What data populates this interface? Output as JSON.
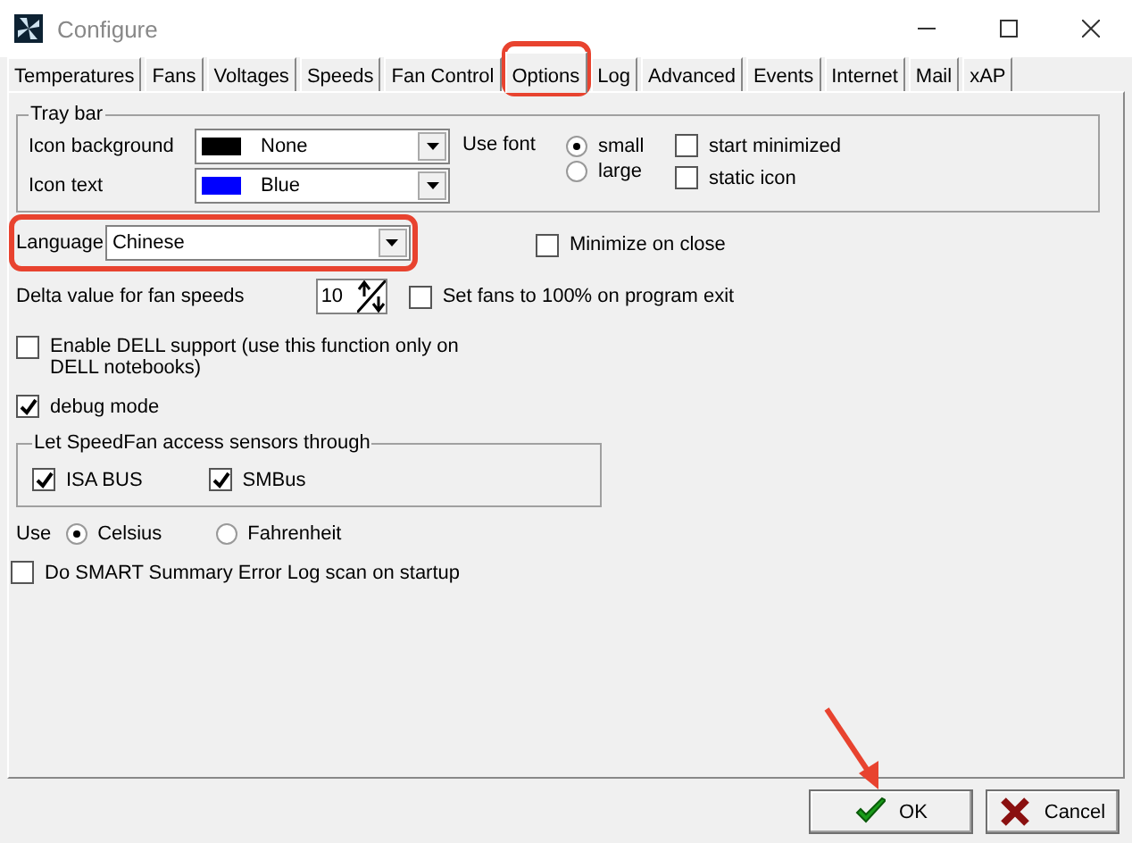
{
  "window": {
    "title": "Configure"
  },
  "tabs": [
    {
      "label": "Temperatures",
      "selected": false
    },
    {
      "label": "Fans",
      "selected": false
    },
    {
      "label": "Voltages",
      "selected": false
    },
    {
      "label": "Speeds",
      "selected": false
    },
    {
      "label": "Fan Control",
      "selected": false
    },
    {
      "label": "Options",
      "selected": true
    },
    {
      "label": "Log",
      "selected": false
    },
    {
      "label": "Advanced",
      "selected": false
    },
    {
      "label": "Events",
      "selected": false
    },
    {
      "label": "Internet",
      "selected": false
    },
    {
      "label": "Mail",
      "selected": false
    },
    {
      "label": "xAP",
      "selected": false
    }
  ],
  "tray_bar": {
    "title": "Tray bar",
    "combos": [
      {
        "label": "Icon background",
        "value": "None",
        "color": "#000000"
      },
      {
        "label": "Icon text",
        "value": "Blue",
        "color": "#0000ff"
      }
    ],
    "use_font": {
      "label": "Use font",
      "options": [
        {
          "label": "small",
          "selected": true
        },
        {
          "label": "large",
          "selected": false
        }
      ]
    },
    "checkboxes": [
      {
        "label": "start minimized",
        "checked": false
      },
      {
        "label": "static icon",
        "checked": false
      }
    ]
  },
  "language": {
    "label": "Language",
    "value": "Chinese"
  },
  "minimize_on_close": {
    "label": "Minimize on close",
    "checked": false
  },
  "delta": {
    "label": "Delta value for fan speeds",
    "value": "10"
  },
  "set_fans": {
    "label": "Set fans to 100% on program exit",
    "checked": false
  },
  "dell_support": {
    "label": "Enable DELL support (use this function only on DELL notebooks)",
    "checked": false
  },
  "debug_mode": {
    "label": "debug mode",
    "checked": true
  },
  "sensors": {
    "title": "Let SpeedFan access sensors through",
    "options": [
      {
        "label": "ISA BUS",
        "checked": true
      },
      {
        "label": "SMBus",
        "checked": true
      }
    ]
  },
  "units": {
    "label": "Use",
    "options": [
      {
        "label": "Celsius",
        "selected": true
      },
      {
        "label": "Fahrenheit",
        "selected": false
      }
    ]
  },
  "smart_scan": {
    "label": "Do SMART Summary Error Log scan on startup",
    "checked": false
  },
  "buttons": [
    {
      "label": "OK",
      "kind": "ok"
    },
    {
      "label": "Cancel",
      "kind": "cancel"
    }
  ]
}
